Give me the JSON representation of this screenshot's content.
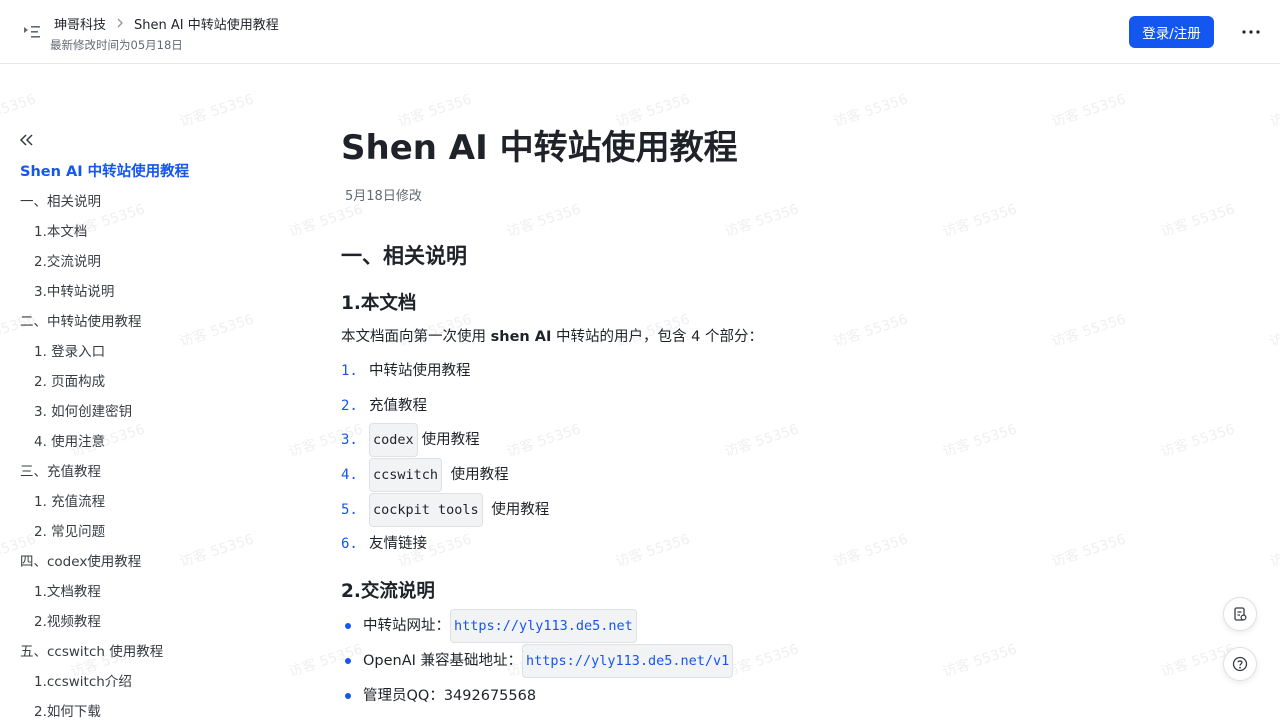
{
  "watermark_text": "访客 55356",
  "header": {
    "breadcrumb_org": "珅哥科技",
    "breadcrumb_doc": "Shen AI 中转站使用教程",
    "modified": "最新修改时间为05月18日",
    "login_label": "登录/注册"
  },
  "sidebar": {
    "title": "Shen AI 中转站使用教程",
    "items": [
      {
        "label": "一、相关说明",
        "level": 1
      },
      {
        "label": "1.本文档",
        "level": 2
      },
      {
        "label": "2.交流说明",
        "level": 2
      },
      {
        "label": "3.中转站说明",
        "level": 2
      },
      {
        "label": "二、中转站使用教程",
        "level": 1
      },
      {
        "label": "1. 登录入口",
        "level": 2
      },
      {
        "label": "2. 页面构成",
        "level": 2
      },
      {
        "label": "3. 如何创建密钥",
        "level": 2
      },
      {
        "label": "4. 使用注意",
        "level": 2
      },
      {
        "label": "三、充值教程",
        "level": 1
      },
      {
        "label": "1. 充值流程",
        "level": 2
      },
      {
        "label": "2. 常见问题",
        "level": 2
      },
      {
        "label": "四、codex使用教程",
        "level": 1
      },
      {
        "label": "1.文档教程",
        "level": 2
      },
      {
        "label": "2.视频教程",
        "level": 2
      },
      {
        "label": "五、ccswitch 使用教程",
        "level": 1
      },
      {
        "label": "1.ccswitch介绍",
        "level": 2
      },
      {
        "label": "2.如何下载",
        "level": 2
      }
    ]
  },
  "main": {
    "title": "Shen AI 中转站使用教程",
    "date": "5月18日修改",
    "section1": "一、相关说明",
    "sub1": "1.本文档",
    "intro_before": "本文档面向第一次使用 ",
    "intro_bold": "shen AI",
    "intro_after": " 中转站的用户，包含 4 个部分：",
    "list": [
      {
        "num": "1.",
        "code": "",
        "text": "中转站使用教程"
      },
      {
        "num": "2.",
        "code": "",
        "text": "充值教程"
      },
      {
        "num": "3.",
        "code": "codex",
        "text": "使用教程"
      },
      {
        "num": "4.",
        "code": "ccswitch",
        "text": " 使用教程"
      },
      {
        "num": "5.",
        "code": "cockpit tools",
        "text": " 使用教程"
      },
      {
        "num": "6.",
        "code": "",
        "text": "友情链接"
      }
    ],
    "sub2": "2.交流说明",
    "bullets": [
      {
        "label": "中转站网址：",
        "link": "https://yly113.de5.net"
      },
      {
        "label": "OpenAI 兼容基础地址：",
        "link": "https://yly113.de5.net/v1"
      },
      {
        "label": "管理员QQ：3492675568",
        "link": ""
      }
    ]
  },
  "colors": {
    "accent": "#1456f0",
    "text": "#1f2329",
    "muted": "#646a73"
  }
}
